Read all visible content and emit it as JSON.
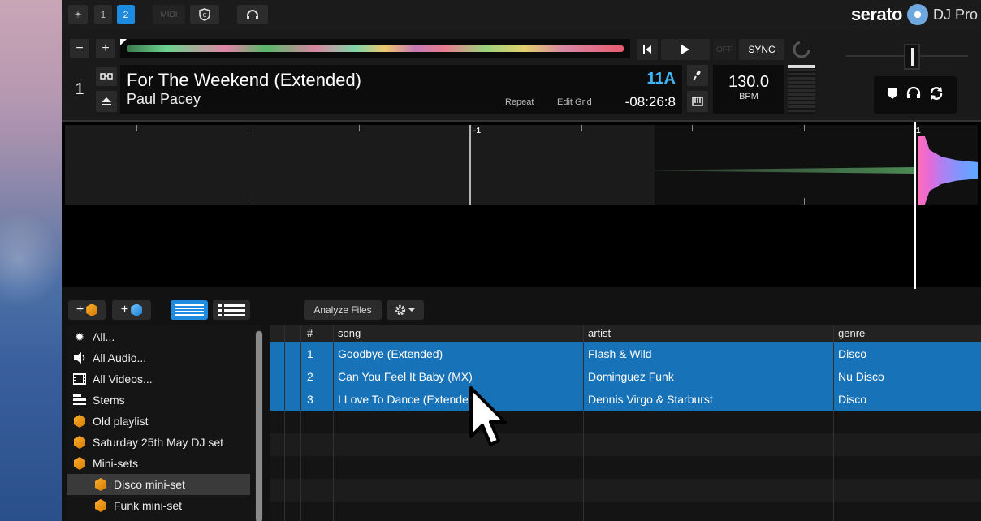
{
  "topbar": {
    "deck1_label": "1",
    "deck2_label": "2",
    "midi_label": "MIDI",
    "brand_name": "serato",
    "brand_product": "DJ Pro"
  },
  "deck": {
    "number": "1",
    "title": "For The Weekend (Extended)",
    "artist": "Paul Pacey",
    "key": "11A",
    "remaining_time": "-08:26:8",
    "repeat_label": "Repeat",
    "edit_grid_label": "Edit Grid",
    "off_label": "OFF",
    "sync_label": "SYNC",
    "bpm_value": "130.0",
    "bpm_unit": "BPM",
    "minus_label": "−",
    "plus_label": "+"
  },
  "waveform": {
    "beat_label_left": "-1",
    "beat_label_right": "1"
  },
  "library_toolbar": {
    "analyze_label": "Analyze Files"
  },
  "sidebar": {
    "items": [
      {
        "label": "All...",
        "icon": "sun-icon"
      },
      {
        "label": "All Audio...",
        "icon": "speaker-icon"
      },
      {
        "label": "All Videos...",
        "icon": "film-icon"
      },
      {
        "label": "Stems",
        "icon": "stems-icon"
      },
      {
        "label": "Old playlist",
        "icon": "crate-icon"
      },
      {
        "label": "Saturday 25th May DJ set",
        "icon": "crate-icon"
      },
      {
        "label": "Mini-sets",
        "icon": "crate-icon"
      },
      {
        "label": "Disco mini-set",
        "icon": "crate-icon"
      },
      {
        "label": "Funk mini-set",
        "icon": "crate-icon"
      }
    ]
  },
  "table": {
    "headers": {
      "num": "#",
      "song": "song",
      "artist": "artist",
      "genre": "genre"
    },
    "rows": [
      {
        "num": "1",
        "song": "Goodbye (Extended)",
        "artist": "Flash & Wild",
        "genre": "Disco"
      },
      {
        "num": "2",
        "song": "Can You Feel It Baby (MX)",
        "artist": "Dominguez Funk",
        "genre": "Nu Disco"
      },
      {
        "num": "3",
        "song": "I Love To Dance (Extended)",
        "artist": "Dennis Virgo & Starburst",
        "genre": "Disco"
      }
    ]
  },
  "colors": {
    "accent": "#1d8be0",
    "key_color": "#3fb4f7",
    "selected_row": "#1872b8"
  }
}
